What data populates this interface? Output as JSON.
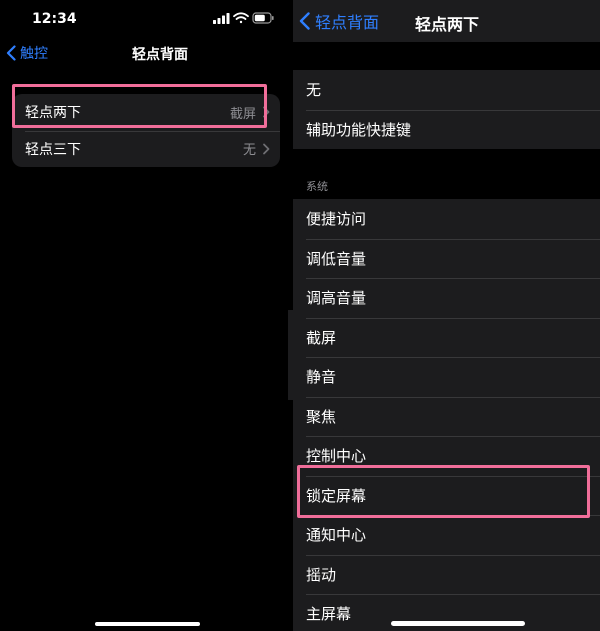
{
  "left": {
    "status_bar": {
      "time": "12:34"
    },
    "nav": {
      "back_label": "触控",
      "title": "轻点背面"
    },
    "rows": [
      {
        "label": "轻点两下",
        "value": "截屏"
      },
      {
        "label": "轻点三下",
        "value": "无"
      }
    ]
  },
  "right": {
    "nav": {
      "back_label": "轻点背面",
      "title": "轻点两下"
    },
    "group1": [
      {
        "label": "无"
      },
      {
        "label": "辅助功能快捷键"
      }
    ],
    "section_header": "系统",
    "group2": [
      {
        "label": "便捷访问"
      },
      {
        "label": "调低音量"
      },
      {
        "label": "调高音量"
      },
      {
        "label": "截屏"
      },
      {
        "label": "静音"
      },
      {
        "label": "聚焦"
      },
      {
        "label": "控制中心"
      },
      {
        "label": "锁定屏幕"
      },
      {
        "label": "通知中心"
      },
      {
        "label": "摇动"
      },
      {
        "label": "主屏幕"
      }
    ]
  },
  "colors": {
    "accent": "#2f7fff",
    "highlight": "#f06e9a",
    "cell_bg": "#1c1c1e",
    "secondary_text": "#8e8e93"
  },
  "icons": [
    "signal-icon",
    "wifi-icon",
    "battery-icon",
    "chevron-left-icon",
    "chevron-right-icon"
  ]
}
